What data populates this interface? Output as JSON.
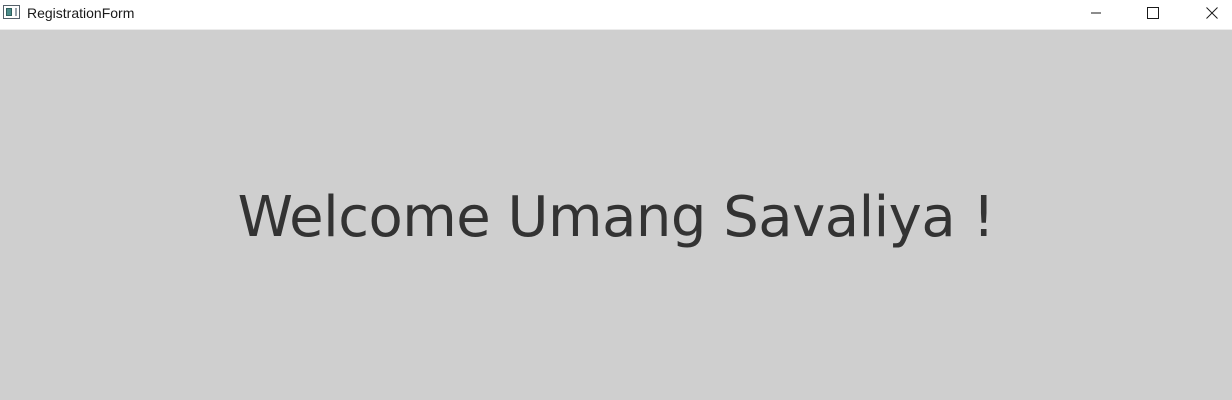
{
  "window": {
    "title": "RegistrationForm",
    "app_icon": "application-window-icon",
    "controls": {
      "minimize_icon": "minimize-icon",
      "maximize_icon": "maximize-icon",
      "close_icon": "close-icon"
    }
  },
  "main": {
    "welcome_text": "Welcome Umang Savaliya !"
  },
  "colors": {
    "titlebar_bg": "#ffffff",
    "content_bg": "#cfcfcf",
    "text": "#333333"
  }
}
